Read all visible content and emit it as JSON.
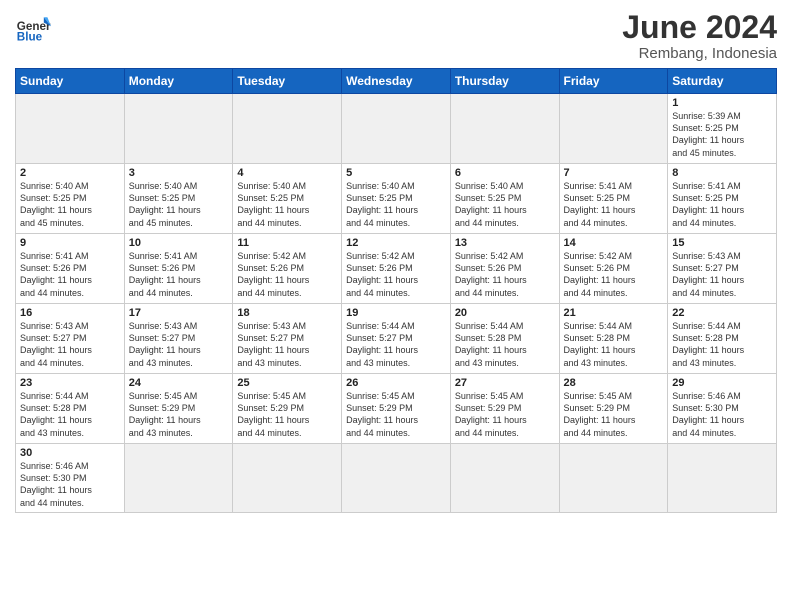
{
  "header": {
    "logo_general": "General",
    "logo_blue": "Blue",
    "title": "June 2024",
    "subtitle": "Rembang, Indonesia"
  },
  "weekdays": [
    "Sunday",
    "Monday",
    "Tuesday",
    "Wednesday",
    "Thursday",
    "Friday",
    "Saturday"
  ],
  "weeks": [
    [
      {
        "day": "",
        "empty": true
      },
      {
        "day": "",
        "empty": true
      },
      {
        "day": "",
        "empty": true
      },
      {
        "day": "",
        "empty": true
      },
      {
        "day": "",
        "empty": true
      },
      {
        "day": "",
        "empty": true
      },
      {
        "day": "1",
        "sunrise": "5:39 AM",
        "sunset": "5:25 PM",
        "daylight": "11 hours and 45 minutes."
      }
    ],
    [
      {
        "day": "2",
        "sunrise": "5:40 AM",
        "sunset": "5:25 PM",
        "daylight": "11 hours and 45 minutes."
      },
      {
        "day": "3",
        "sunrise": "5:40 AM",
        "sunset": "5:25 PM",
        "daylight": "11 hours and 45 minutes."
      },
      {
        "day": "4",
        "sunrise": "5:40 AM",
        "sunset": "5:25 PM",
        "daylight": "11 hours and 44 minutes."
      },
      {
        "day": "5",
        "sunrise": "5:40 AM",
        "sunset": "5:25 PM",
        "daylight": "11 hours and 44 minutes."
      },
      {
        "day": "6",
        "sunrise": "5:40 AM",
        "sunset": "5:25 PM",
        "daylight": "11 hours and 44 minutes."
      },
      {
        "day": "7",
        "sunrise": "5:41 AM",
        "sunset": "5:25 PM",
        "daylight": "11 hours and 44 minutes."
      },
      {
        "day": "8",
        "sunrise": "5:41 AM",
        "sunset": "5:25 PM",
        "daylight": "11 hours and 44 minutes."
      }
    ],
    [
      {
        "day": "9",
        "sunrise": "5:41 AM",
        "sunset": "5:26 PM",
        "daylight": "11 hours and 44 minutes."
      },
      {
        "day": "10",
        "sunrise": "5:41 AM",
        "sunset": "5:26 PM",
        "daylight": "11 hours and 44 minutes."
      },
      {
        "day": "11",
        "sunrise": "5:42 AM",
        "sunset": "5:26 PM",
        "daylight": "11 hours and 44 minutes."
      },
      {
        "day": "12",
        "sunrise": "5:42 AM",
        "sunset": "5:26 PM",
        "daylight": "11 hours and 44 minutes."
      },
      {
        "day": "13",
        "sunrise": "5:42 AM",
        "sunset": "5:26 PM",
        "daylight": "11 hours and 44 minutes."
      },
      {
        "day": "14",
        "sunrise": "5:42 AM",
        "sunset": "5:26 PM",
        "daylight": "11 hours and 44 minutes."
      },
      {
        "day": "15",
        "sunrise": "5:43 AM",
        "sunset": "5:27 PM",
        "daylight": "11 hours and 44 minutes."
      }
    ],
    [
      {
        "day": "16",
        "sunrise": "5:43 AM",
        "sunset": "5:27 PM",
        "daylight": "11 hours and 44 minutes."
      },
      {
        "day": "17",
        "sunrise": "5:43 AM",
        "sunset": "5:27 PM",
        "daylight": "11 hours and 43 minutes."
      },
      {
        "day": "18",
        "sunrise": "5:43 AM",
        "sunset": "5:27 PM",
        "daylight": "11 hours and 43 minutes."
      },
      {
        "day": "19",
        "sunrise": "5:44 AM",
        "sunset": "5:27 PM",
        "daylight": "11 hours and 43 minutes."
      },
      {
        "day": "20",
        "sunrise": "5:44 AM",
        "sunset": "5:28 PM",
        "daylight": "11 hours and 43 minutes."
      },
      {
        "day": "21",
        "sunrise": "5:44 AM",
        "sunset": "5:28 PM",
        "daylight": "11 hours and 43 minutes."
      },
      {
        "day": "22",
        "sunrise": "5:44 AM",
        "sunset": "5:28 PM",
        "daylight": "11 hours and 43 minutes."
      }
    ],
    [
      {
        "day": "23",
        "sunrise": "5:44 AM",
        "sunset": "5:28 PM",
        "daylight": "11 hours and 43 minutes."
      },
      {
        "day": "24",
        "sunrise": "5:45 AM",
        "sunset": "5:29 PM",
        "daylight": "11 hours and 43 minutes."
      },
      {
        "day": "25",
        "sunrise": "5:45 AM",
        "sunset": "5:29 PM",
        "daylight": "11 hours and 44 minutes."
      },
      {
        "day": "26",
        "sunrise": "5:45 AM",
        "sunset": "5:29 PM",
        "daylight": "11 hours and 44 minutes."
      },
      {
        "day": "27",
        "sunrise": "5:45 AM",
        "sunset": "5:29 PM",
        "daylight": "11 hours and 44 minutes."
      },
      {
        "day": "28",
        "sunrise": "5:45 AM",
        "sunset": "5:29 PM",
        "daylight": "11 hours and 44 minutes."
      },
      {
        "day": "29",
        "sunrise": "5:46 AM",
        "sunset": "5:30 PM",
        "daylight": "11 hours and 44 minutes."
      }
    ],
    [
      {
        "day": "30",
        "sunrise": "5:46 AM",
        "sunset": "5:30 PM",
        "daylight": "11 hours and 44 minutes."
      },
      {
        "day": "",
        "empty": true
      },
      {
        "day": "",
        "empty": true
      },
      {
        "day": "",
        "empty": true
      },
      {
        "day": "",
        "empty": true
      },
      {
        "day": "",
        "empty": true
      },
      {
        "day": "",
        "empty": true
      }
    ]
  ],
  "labels": {
    "sunrise": "Sunrise:",
    "sunset": "Sunset:",
    "daylight": "Daylight:"
  }
}
